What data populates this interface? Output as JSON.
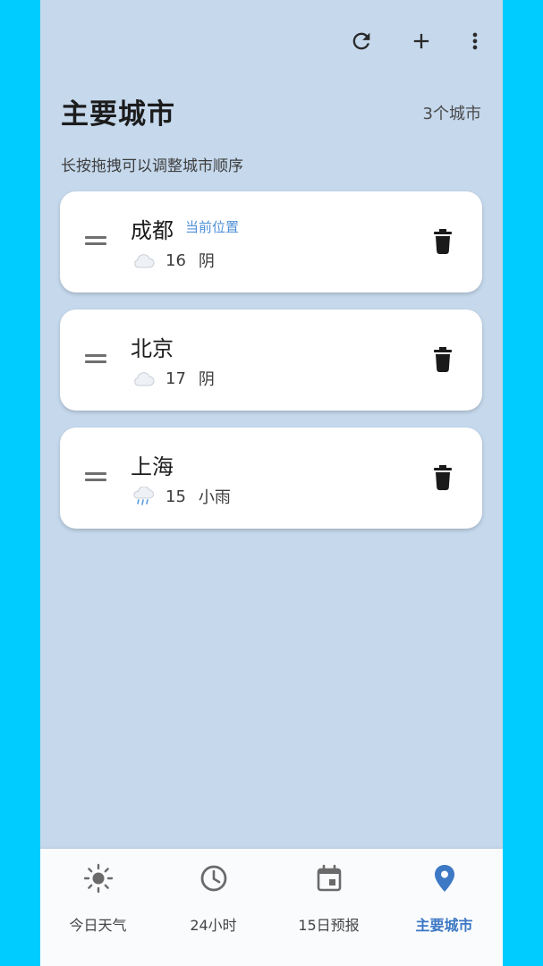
{
  "header": {
    "title": "主要城市",
    "city_count": "3个城市",
    "hint": "长按拖拽可以调整城市顺序",
    "actions": [
      "refresh-icon",
      "add-icon",
      "more-vert-icon"
    ]
  },
  "cities": [
    {
      "name": "成都",
      "badge": "当前位置",
      "temp": "16",
      "condition": "阴",
      "icon": "cloud-icon"
    },
    {
      "name": "北京",
      "badge": "",
      "temp": "17",
      "condition": "阴",
      "icon": "cloud-icon"
    },
    {
      "name": "上海",
      "badge": "",
      "temp": "15",
      "condition": "小雨",
      "icon": "rain-cloud-icon"
    }
  ],
  "nav": {
    "items": [
      {
        "label": "今日天气",
        "icon": "sun-icon"
      },
      {
        "label": "24小时",
        "icon": "clock-icon"
      },
      {
        "label": "15日预报",
        "icon": "calendar-icon"
      },
      {
        "label": "主要城市",
        "icon": "location-pin-icon"
      }
    ],
    "active_index": 3
  },
  "colors": {
    "background": "#C5D8EC",
    "accent": "#3C78C4",
    "badge": "#4F8FD6",
    "outer": "#00CCFF"
  }
}
